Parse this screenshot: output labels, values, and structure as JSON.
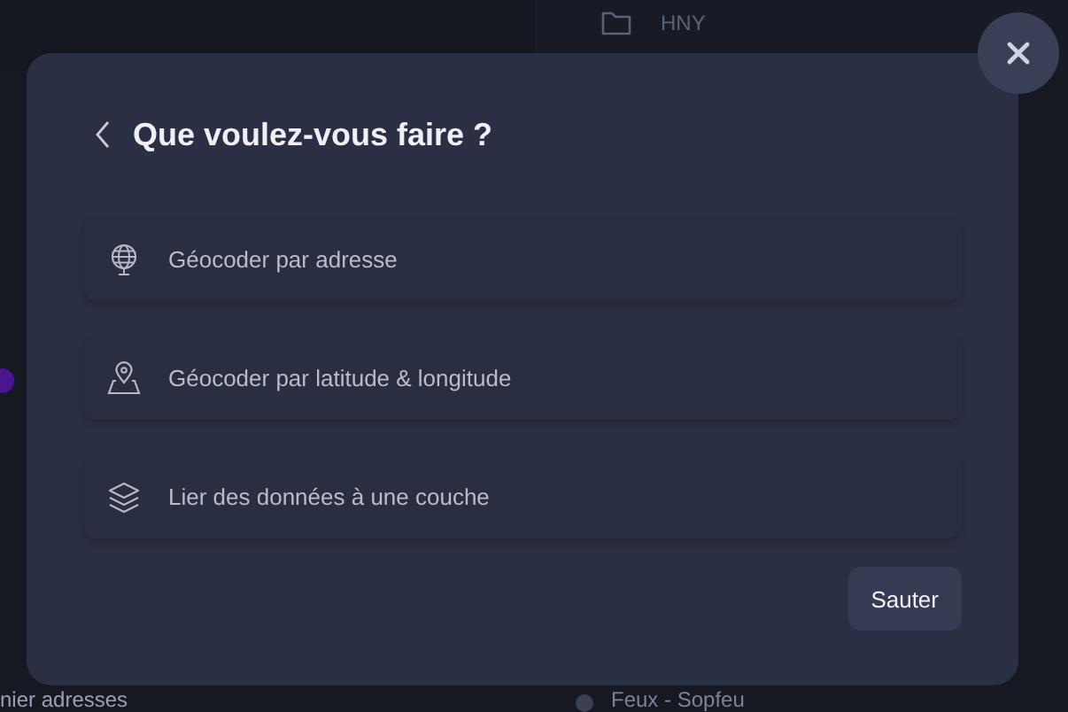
{
  "background": {
    "folder_label": "HNY",
    "bottom_left_text": "nier adresses",
    "bottom_right_text": "Feux - Sopfeu"
  },
  "dialog": {
    "title": "Que voulez-vous faire ?",
    "options": [
      {
        "kind": "globe",
        "label": "Géocoder par adresse"
      },
      {
        "kind": "map-pin",
        "label": "Géocoder par latitude & longitude"
      },
      {
        "kind": "layers",
        "label": "Lier des données à une couche"
      }
    ],
    "skip_button": "Sauter"
  }
}
